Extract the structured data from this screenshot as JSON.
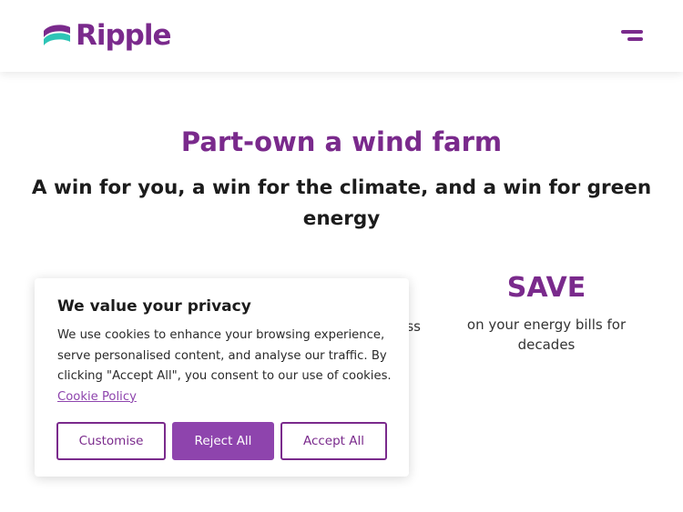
{
  "header": {
    "brand_name": "Ripple",
    "brand_color": "#7a2a8c",
    "logo_accent_color": "#2ec4b6",
    "menu_icon": "hamburger-menu-icon"
  },
  "hero": {
    "title": "Part-own a wind farm",
    "subtitle": "A win for you, a win for the climate, and a win for green energy"
  },
  "stats": {
    "partial_text": "ss",
    "save_title": "SAVE",
    "save_text": "on your energy bills for decades"
  },
  "cookie_banner": {
    "title": "We value your privacy",
    "text": "We use cookies to enhance your browsing experience, serve personalised content, and analyse our traffic. By clicking \"Accept All\", you consent to our use of cookies.",
    "link_text": "Cookie Policy",
    "buttons": {
      "customise": "Customise",
      "reject": "Reject All",
      "accept": "Accept All"
    },
    "accent_color": "#8e44ad"
  }
}
